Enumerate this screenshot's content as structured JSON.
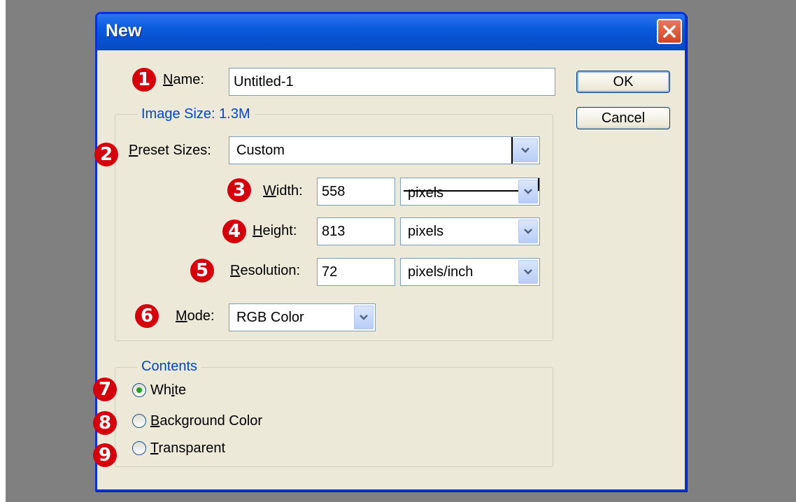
{
  "dialog": {
    "title": "New",
    "ok_label": "OK",
    "cancel_label": "Cancel"
  },
  "name": {
    "label": "Name:",
    "value": "Untitled-1"
  },
  "image_size": {
    "legend": "Image Size: 1.3M",
    "preset": {
      "label": "Preset Sizes:",
      "value": "Custom"
    },
    "width": {
      "label": "Width:",
      "value": "558",
      "unit": "pixels"
    },
    "height": {
      "label": "Height:",
      "value": "813",
      "unit": "pixels"
    },
    "resolution": {
      "label": "Resolution:",
      "value": "72",
      "unit": "pixels/inch"
    },
    "mode": {
      "label": "Mode:",
      "value": "RGB Color"
    }
  },
  "contents": {
    "legend": "Contents",
    "options": [
      {
        "label": "White",
        "selected": true
      },
      {
        "label": "Background Color",
        "selected": false
      },
      {
        "label": "Transparent",
        "selected": false
      }
    ]
  },
  "badges": [
    "1",
    "2",
    "3",
    "4",
    "5",
    "6",
    "7",
    "8",
    "9"
  ],
  "colors": {
    "titlebar": "#0a5bdd",
    "badge": "#d4000c",
    "dialog_bg": "#ece9d8",
    "legend_text": "#0046d5"
  }
}
